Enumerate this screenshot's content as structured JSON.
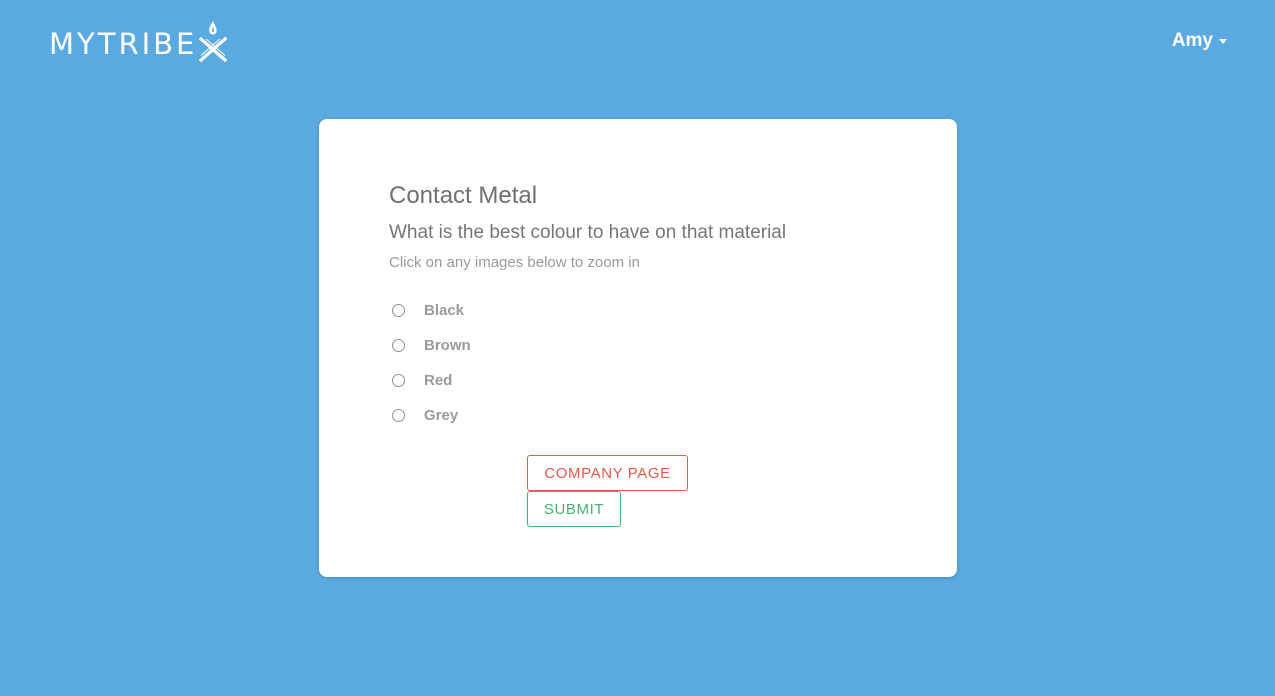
{
  "brand": {
    "name": "MYTRIBE",
    "logo_icon": "flame-x-icon"
  },
  "user_menu": {
    "name": "Amy",
    "icon": "caret-down-icon"
  },
  "card": {
    "title": "Contact Metal",
    "question": "What is the best colour to have on that material",
    "hint": "Click on any images below to zoom in",
    "options": [
      {
        "label": "Black",
        "selected": false
      },
      {
        "label": "Brown",
        "selected": false
      },
      {
        "label": "Red",
        "selected": false
      },
      {
        "label": "Grey",
        "selected": false
      }
    ],
    "company_button": "COMPANY PAGE",
    "submit_button": "SUBMIT"
  },
  "colors": {
    "background": "#5aaae1",
    "card": "#ffffff",
    "company_button": "#e25a4a",
    "submit_button": "#3fb66f"
  }
}
